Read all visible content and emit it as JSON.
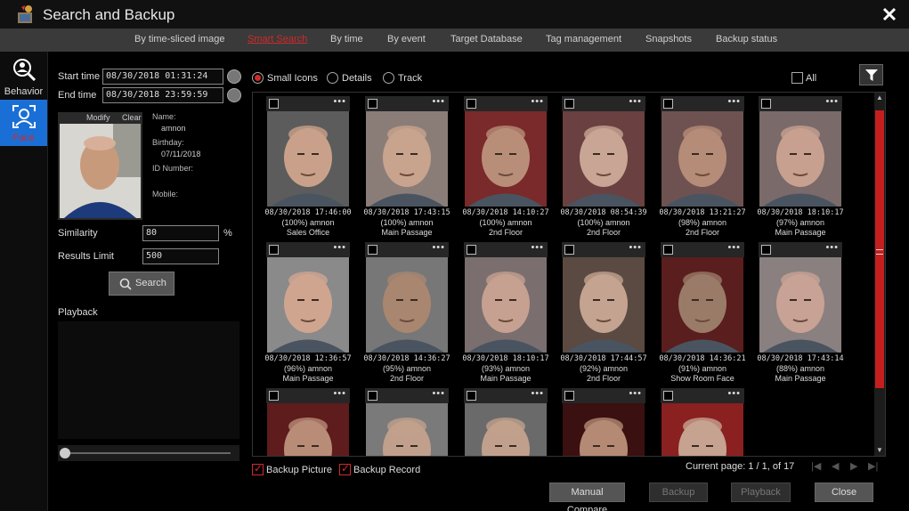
{
  "app": {
    "title": "Search and Backup"
  },
  "tabs": [
    "By time-sliced image",
    "Smart Search",
    "By time",
    "By event",
    "Target Database",
    "Tag management",
    "Snapshots",
    "Backup status"
  ],
  "active_tab": "Smart Search",
  "nav": {
    "behavior": "Behavior",
    "face": "Face"
  },
  "search": {
    "start_label": "Start time",
    "start_value": "08/30/2018 01:31:24",
    "end_label": "End time",
    "end_value": "08/30/2018 23:59:59",
    "similarity_label": "Similarity",
    "similarity_value": "80",
    "similarity_unit": "%",
    "limit_label": "Results Limit",
    "limit_value": "500",
    "button": "Search"
  },
  "profile": {
    "modify": "Modify",
    "clear": "Clear",
    "name_label": "Name:",
    "name": "amnon",
    "birthday_label": "Birthday:",
    "birthday": "07/11/2018",
    "id_label": "ID Number:",
    "mobile_label": "Mobile:"
  },
  "playback_label": "Playback",
  "view": {
    "small_icons": "Small Icons",
    "details": "Details",
    "track": "Track",
    "selected": "Small Icons",
    "all": "All"
  },
  "results": [
    {
      "l1": "08/30/2018 17:46:00",
      "l2": "(100%) amnon",
      "l3": "Sales Office",
      "tone": "#c9a18a",
      "bg": "#5c5c5c"
    },
    {
      "l1": "08/30/2018 17:43:15",
      "l2": "(100%) amnon",
      "l3": "Main Passage",
      "tone": "#c8a38d",
      "bg": "#8a7d78"
    },
    {
      "l1": "08/30/2018 14:10:27",
      "l2": "(100%) amnon",
      "l3": "2nd Floor",
      "tone": "#b98e78",
      "bg": "#7a2a2a"
    },
    {
      "l1": "08/30/2018 08:54:39",
      "l2": "(100%) amnon",
      "l3": "2nd Floor",
      "tone": "#c8a594",
      "bg": "#6a4040"
    },
    {
      "l1": "08/30/2018 13:21:27",
      "l2": "(98%) amnon",
      "l3": "2nd Floor",
      "tone": "#b58c78",
      "bg": "#6e5252"
    },
    {
      "l1": "08/30/2018 18:10:17",
      "l2": "(97%) amnon",
      "l3": "Main Passage",
      "tone": "#c7a090",
      "bg": "#7a6a6a"
    },
    {
      "l1": "08/30/2018 12:36:57",
      "l2": "(96%) amnon",
      "l3": "Main Passage",
      "tone": "#cfa590",
      "bg": "#8a8a8a"
    },
    {
      "l1": "08/30/2018 14:36:27",
      "l2": "(95%) amnon",
      "l3": "2nd Floor",
      "tone": "#a88670",
      "bg": "#777"
    },
    {
      "l1": "08/30/2018 18:10:17",
      "l2": "(93%) amnon",
      "l3": "Main Passage",
      "tone": "#c6a090",
      "bg": "#7a6e6e"
    },
    {
      "l1": "08/30/2018 17:44:57",
      "l2": "(92%) amnon",
      "l3": "2nd Floor",
      "tone": "#c4a390",
      "bg": "#5a4a42"
    },
    {
      "l1": "08/30/2018 14:36:21",
      "l2": "(91%) amnon",
      "l3": "Show Room Face",
      "tone": "#9a7b68",
      "bg": "#5a1e1e"
    },
    {
      "l1": "08/30/2018 17:43:14",
      "l2": "(88%) amnon",
      "l3": "Main Passage",
      "tone": "#c8a294",
      "bg": "#8a8080"
    },
    {
      "l1": "",
      "l2": "",
      "l3": "",
      "tone": "#b98c78",
      "bg": "#5e1c1c"
    },
    {
      "l1": "",
      "l2": "",
      "l3": "",
      "tone": "#c0a08c",
      "bg": "#7a7a7a"
    },
    {
      "l1": "",
      "l2": "",
      "l3": "",
      "tone": "#c0a08c",
      "bg": "#6a6a6a"
    },
    {
      "l1": "",
      "l2": "",
      "l3": "",
      "tone": "#b48a74",
      "bg": "#3a1010"
    },
    {
      "l1": "",
      "l2": "",
      "l3": "",
      "tone": "#c6a290",
      "bg": "#8a2020"
    }
  ],
  "backup": {
    "picture": "Backup Picture",
    "record": "Backup Record"
  },
  "pagination": {
    "text": "Current page: 1 / 1, of 17"
  },
  "buttons": {
    "manual_compare": "Manual Compare",
    "backup": "Backup",
    "playback": "Playback",
    "close": "Close"
  },
  "colors": {
    "accent": "#d12a2a",
    "nav_active": "#1a6fd6"
  }
}
